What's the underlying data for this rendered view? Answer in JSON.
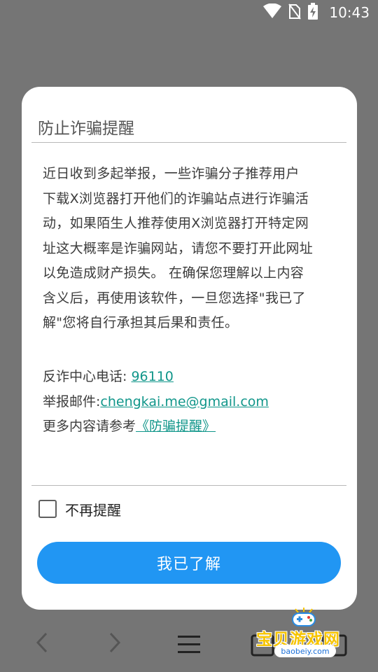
{
  "status_bar": {
    "time": "10:43",
    "icons": [
      "wifi-icon",
      "no-sim-icon",
      "battery-charging-icon"
    ]
  },
  "dialog": {
    "title": "防止诈骗提醒",
    "message_lines": [
      "近日收到多起举报，一些诈骗分子推荐用户",
      "下载X浏览器打开他们的诈骗站点进行诈骗活",
      "动，如果陌生人推荐使用X浏览器打开特定网",
      "址这大概率是诈骗网站，请您不要打开此网址",
      "以免造成财产损失。 在确保您理解以上内容",
      "含义后，再使用该软件，一旦您选择\"我已了",
      "解\"您将自行承担其后果和责任。"
    ],
    "phone_label": "反诈中心电话: ",
    "phone_value": "96110",
    "email_label": "举报邮件:",
    "email_value": "chengkai.me@gmail.com",
    "more_label": "更多内容请参考",
    "more_link": "《防骗提醒》",
    "checkbox_label": "不再提醒",
    "checkbox_checked": false,
    "confirm_button": "我已了解"
  },
  "bottom_nav": {
    "icons": [
      "back-arrow-icon",
      "forward-arrow-icon",
      "menu-icon",
      "tabs-icon"
    ]
  },
  "watermark": {
    "title": "宝贝游戏网",
    "domain": "baobeiy.com"
  },
  "colors": {
    "backdrop": "#757575",
    "accent": "#2196f3",
    "link": "#11968a"
  }
}
